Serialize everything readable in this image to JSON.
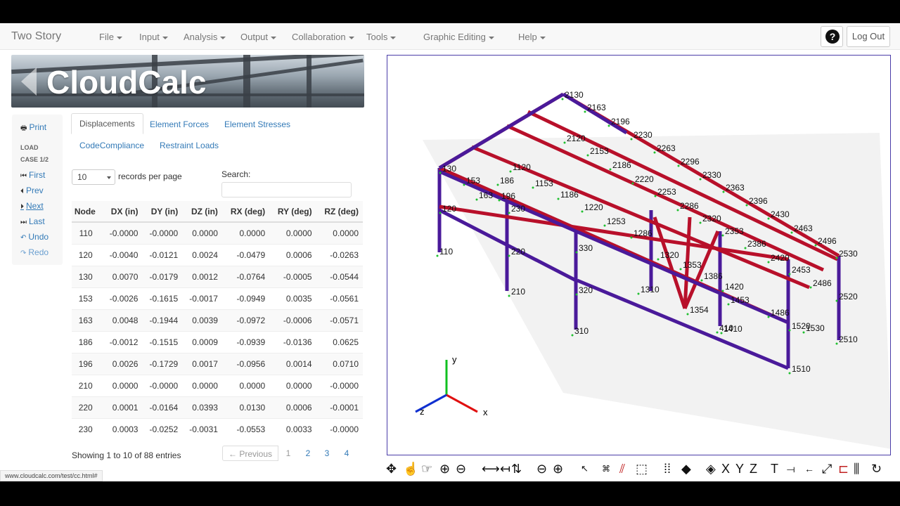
{
  "app": {
    "title": "Two Story",
    "menus": [
      "File",
      "Input",
      "Analysis",
      "Output",
      "Collaboration",
      "Tools",
      "Graphic Editing",
      "Help"
    ],
    "help_symbol": "?",
    "logout_label": "Log Out"
  },
  "banner": {
    "logo_text": "CloudCalc"
  },
  "sidebar": {
    "print": "Print",
    "load_case_line1": "LOAD",
    "load_case_line2": "CASE 1/2",
    "first": "First",
    "prev": "Prev",
    "next": "Next",
    "last": "Last",
    "undo": "Undo",
    "redo": "Redo"
  },
  "tabs": {
    "displacements": "Displacements",
    "element_forces": "Element Forces",
    "element_stresses": "Element Stresses",
    "code_compliance": "CodeCompliance",
    "restraint_loads": "Restraint Loads"
  },
  "table_controls": {
    "page_size": "10",
    "records_per_page": "records per page",
    "search_label": "Search:"
  },
  "table": {
    "columns": [
      "Node",
      "DX (in)",
      "DY (in)",
      "DZ (in)",
      "RX (deg)",
      "RY (deg)",
      "RZ (deg)"
    ],
    "rows": [
      [
        "110",
        "-0.0000",
        "-0.0000",
        "0.0000",
        "0.0000",
        "0.0000",
        "0.0000"
      ],
      [
        "120",
        "-0.0040",
        "-0.0121",
        "0.0024",
        "-0.0479",
        "0.0006",
        "-0.0263"
      ],
      [
        "130",
        "0.0070",
        "-0.0179",
        "0.0012",
        "-0.0764",
        "-0.0005",
        "-0.0544"
      ],
      [
        "153",
        "-0.0026",
        "-0.1615",
        "-0.0017",
        "-0.0949",
        "0.0035",
        "-0.0561"
      ],
      [
        "163",
        "0.0048",
        "-0.1944",
        "0.0039",
        "-0.0972",
        "-0.0006",
        "-0.0571"
      ],
      [
        "186",
        "-0.0012",
        "-0.1515",
        "0.0009",
        "-0.0939",
        "-0.0136",
        "0.0625"
      ],
      [
        "196",
        "0.0026",
        "-0.1729",
        "0.0017",
        "-0.0956",
        "0.0014",
        "0.0710"
      ],
      [
        "210",
        "0.0000",
        "-0.0000",
        "0.0000",
        "0.0000",
        "0.0000",
        "-0.0000"
      ],
      [
        "220",
        "0.0001",
        "-0.0164",
        "0.0393",
        "0.0130",
        "0.0006",
        "-0.0001"
      ],
      [
        "230",
        "0.0003",
        "-0.0252",
        "-0.0031",
        "-0.0553",
        "0.0033",
        "-0.0000"
      ]
    ],
    "info": "Showing 1 to 10 of 88 entries",
    "prev_label": "← Previous",
    "pages": [
      "1",
      "2",
      "3",
      "4"
    ]
  },
  "viewport": {
    "node_labels": [
      "2130",
      "2163",
      "2196",
      "2230",
      "2263",
      "2296",
      "2330",
      "2363",
      "2396",
      "2430",
      "2463",
      "2496",
      "2530",
      "2520",
      "2510",
      "2486",
      "2453",
      "2420",
      "2386",
      "2353",
      "2320",
      "2286",
      "2253",
      "2220",
      "2186",
      "2153",
      "2120",
      "1530",
      "1520",
      "1510",
      "1486",
      "1453",
      "1420",
      "1386",
      "1353",
      "1320",
      "1286",
      "1253",
      "1220",
      "1186",
      "1153",
      "1120",
      "110",
      "120",
      "130",
      "153",
      "163",
      "186",
      "196",
      "210",
      "220",
      "230",
      "310",
      "320",
      "330",
      "410",
      "1310",
      "1354",
      "1410"
    ],
    "axes": {
      "x": "x",
      "y": "y",
      "z": "z"
    }
  },
  "status_url": "www.cloudcalc.com/test/cc.html#",
  "colors": {
    "member_purple": "#4a1a9a",
    "member_red": "#b8102a",
    "member_dark": "#6a1030",
    "link": "#337ab7"
  }
}
